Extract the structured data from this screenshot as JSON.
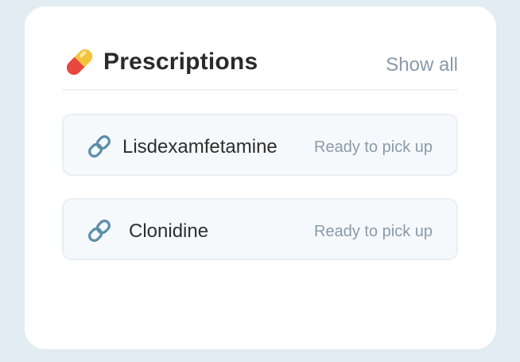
{
  "card": {
    "title": "Prescriptions",
    "title_icon": "pill-icon",
    "show_all_label": "Show all"
  },
  "prescriptions": [
    {
      "name": "Lisdexamfetamine",
      "status": "Ready to pick up",
      "icon": "link-icon"
    },
    {
      "name": "Clonidine",
      "status": "Ready to pick up",
      "icon": "link-icon"
    }
  ],
  "colors": {
    "page_background": "#e2ecf3",
    "card_background": "#ffffff",
    "item_background": "#f6f9fc",
    "muted_text": "#8a9aa8",
    "link_icon": "#5b8fa8"
  }
}
